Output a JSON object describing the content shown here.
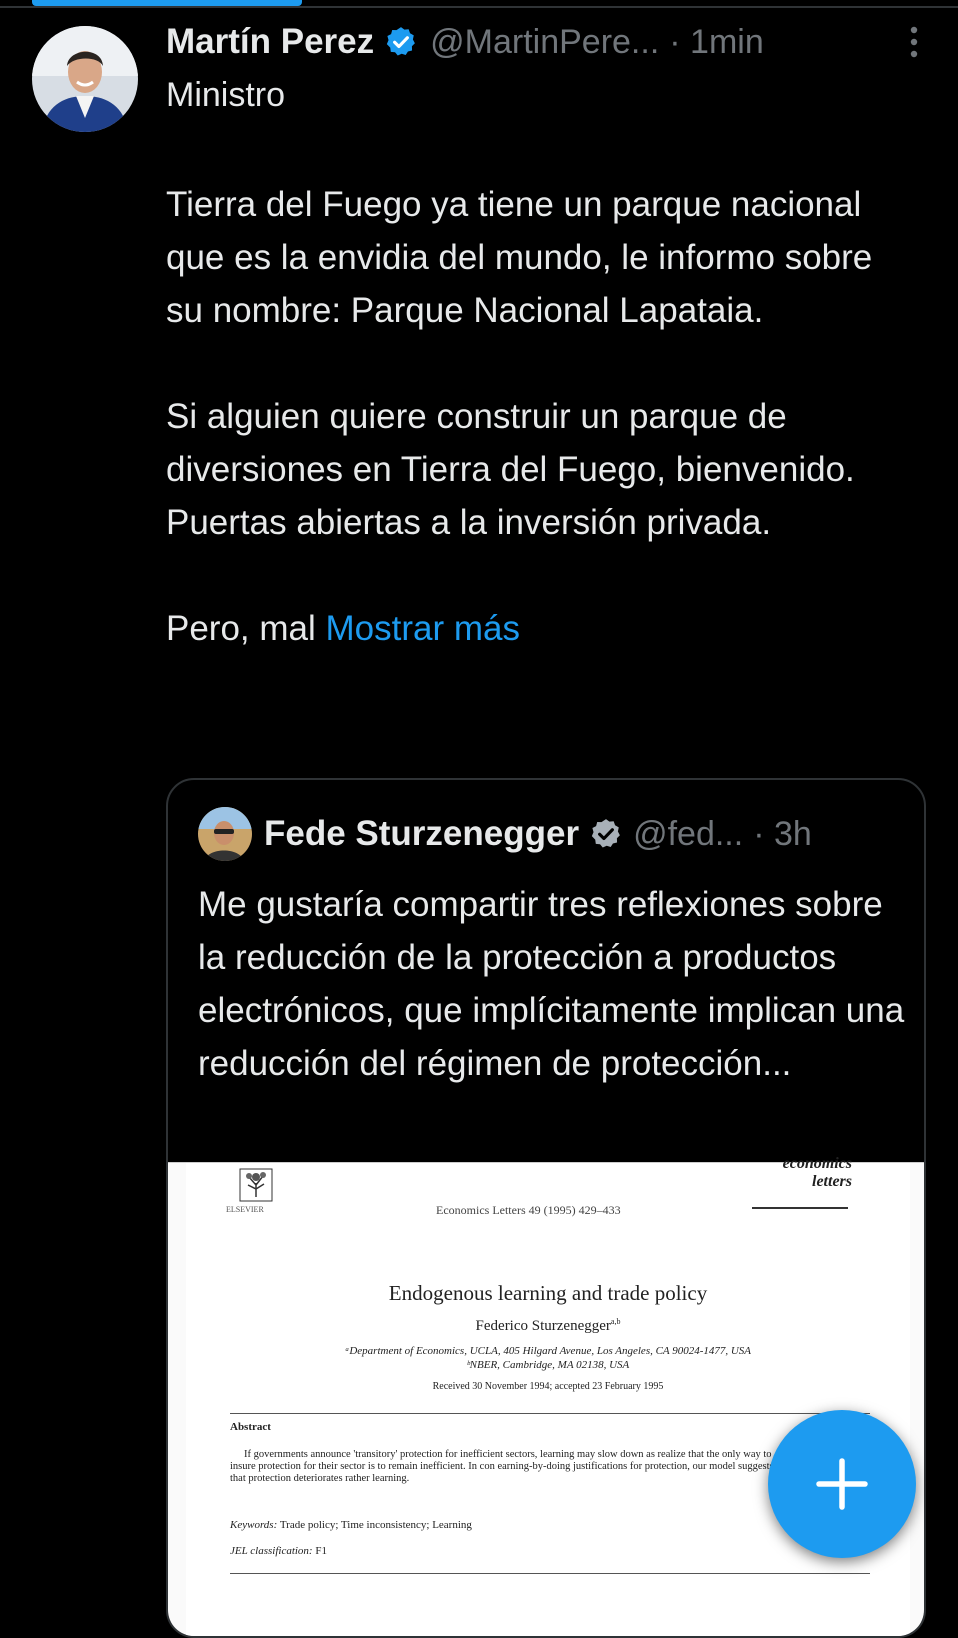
{
  "tweet": {
    "author_name": "Martín Perez",
    "handle": "@MartinPere...",
    "time": "· 1min",
    "subtitle": "Ministro",
    "paragraphs": [
      "Tierra del Fuego ya tiene un parque nacional que es la envidia del mundo, le informo sobre su nombre: Parque Nacional Lapataia.",
      "Si alguien quiere construir un parque de diversiones en Tierra del Fuego, bienvenido. Puertas abiertas a la inversión privada."
    ],
    "truncated_text": "Pero, mal ",
    "show_more": "Mostrar más"
  },
  "quote": {
    "author_name": "Fede Sturzenegger",
    "handle": "@fed...",
    "time": "· 3h",
    "text": "Me gustaría compartir tres reflexiones sobre la reducción de la protección a productos electrónicos, que implícitamente implican una reducción del régimen de protección...",
    "paper": {
      "publisher": "ELSEVIER",
      "journal_ref": "Economics Letters 49 (1995) 429–433",
      "journal_name_line1": "economics",
      "journal_name_line2": "letters",
      "title": "Endogenous learning and trade policy",
      "author": "Federico Sturzenegger",
      "author_sup": "a,b",
      "affiliation1": "ᵃDepartment of Economics, UCLA, 405 Hilgard Avenue, Los Angeles, CA 90024-1477, USA",
      "affiliation2": "ᵇNBER, Cambridge, MA 02138, USA",
      "received": "Received 30 November 1994; accepted 23 February 1995",
      "abstract_heading": "Abstract",
      "abstract": "If governments announce 'transitory' protection for inefficient sectors, learning may slow down as realize that the only way to insure protection for their sector is to remain inefficient. In con earning-by-doing justifications for protection, our model suggests that protection deteriorates rather learning.",
      "keywords_label": "Keywords:",
      "keywords": " Trade policy; Time inconsistency; Learning",
      "jel_label": "JEL classification:",
      "jel": " F1"
    }
  },
  "colors": {
    "accent": "#1d9bf0",
    "background": "#000000",
    "text": "#e7e9ea",
    "muted": "#71767b",
    "border": "#2f3336"
  },
  "icons": {
    "verified": "verified-badge-icon",
    "more": "more-vertical-icon",
    "compose": "plus-icon"
  }
}
